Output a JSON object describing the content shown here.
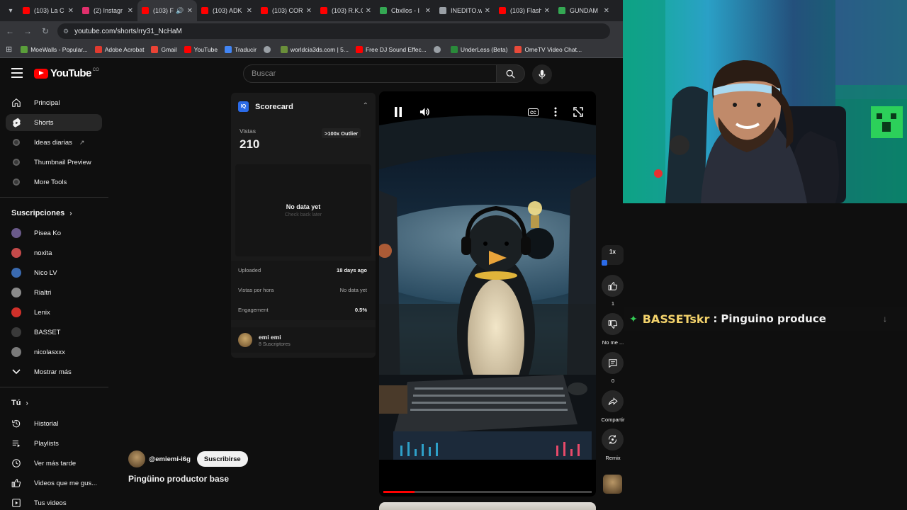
{
  "browser": {
    "tabs": [
      {
        "title": "(103) La C",
        "color": "#ff0000"
      },
      {
        "title": "(2) Instagr",
        "color": "#e1306c"
      },
      {
        "title": "(103) F",
        "color": "#ff0000",
        "active": true
      },
      {
        "title": "(103) ADK",
        "color": "#ff0000"
      },
      {
        "title": "(103) COR",
        "color": "#ff0000"
      },
      {
        "title": "(103) R.K.C",
        "color": "#ff0000"
      },
      {
        "title": "Cbxllos - I",
        "color": "#34a853"
      },
      {
        "title": "INEDITO.w",
        "color": "#9aa0a6"
      },
      {
        "title": "(103) Flash",
        "color": "#ff0000"
      },
      {
        "title": "GUNDAM",
        "color": "#34a853"
      }
    ],
    "url": "youtube.com/shorts/rry31_NcHaM",
    "bookmarks": [
      {
        "label": "MoeWalls - Popular...",
        "color": "#5a9e3a"
      },
      {
        "label": "Adobe Acrobat",
        "color": "#e03a2f"
      },
      {
        "label": "Gmail",
        "color": "#ea4335"
      },
      {
        "label": "YouTube",
        "color": "#ff0000"
      },
      {
        "label": "Traducir",
        "color": "#4285f4"
      },
      {
        "label": "",
        "color": "#9aa0a6"
      },
      {
        "label": "worldcia3ds.com | 5...",
        "color": "#6a8f3a"
      },
      {
        "label": "Free DJ Sound Effec...",
        "color": "#ff0000"
      },
      {
        "label": "",
        "color": "#9aa0a6"
      },
      {
        "label": "UnderLess (Beta)",
        "color": "#2a8a3a"
      },
      {
        "label": "OmeTV Video Chat...",
        "color": "#e84a3a"
      }
    ]
  },
  "youtube": {
    "logo_text": "YouTube",
    "logo_badge": "CO",
    "search_placeholder": "Buscar"
  },
  "sidebar": {
    "main": [
      {
        "label": "Principal",
        "icon": "home-icon"
      },
      {
        "label": "Shorts",
        "icon": "shorts-icon",
        "active": true
      },
      {
        "label": "Ideas diarias",
        "icon": "ideas-icon"
      },
      {
        "label": "Thumbnail Preview",
        "icon": "thumbnail-icon"
      },
      {
        "label": "More Tools",
        "icon": "tools-icon"
      }
    ],
    "subs_title": "Suscripciones",
    "subs": [
      {
        "label": "Pisea Ko",
        "color": "#6a5a8a"
      },
      {
        "label": "noxita",
        "color": "#c44a4a"
      },
      {
        "label": "Nico LV",
        "color": "#3a6ab0"
      },
      {
        "label": "Rialtri",
        "color": "#8a8a8a"
      },
      {
        "label": "Lenix",
        "color": "#d0302a"
      },
      {
        "label": "BASSET",
        "color": "#3a3a3a"
      },
      {
        "label": "nicolasxxx",
        "color": "#7a7a7a"
      }
    ],
    "show_more": "Mostrar más",
    "you_title": "Tú",
    "you": [
      {
        "label": "Historial",
        "icon": "history-icon"
      },
      {
        "label": "Playlists",
        "icon": "playlists-icon"
      },
      {
        "label": "Ver más tarde",
        "icon": "watch-later-icon"
      },
      {
        "label": "Videos que me gus...",
        "icon": "liked-icon"
      },
      {
        "label": "Tus videos",
        "icon": "your-videos-icon"
      }
    ]
  },
  "scorecard": {
    "title": "Scorecard",
    "logo": "IQ",
    "views_label": "Vistas",
    "views_value": "210",
    "outlier_badge": ">100x Outlier",
    "no_data": "No data yet",
    "no_data_sub": "Check back later",
    "stats": [
      {
        "key": "Uploaded",
        "value": "18 days ago",
        "dim": false
      },
      {
        "key": "Vistas por hora",
        "value": "No data yet",
        "dim": true
      },
      {
        "key": "Engagement",
        "value": "0.5%",
        "dim": false
      }
    ],
    "channel_name": "emi emi",
    "channel_subs": "8 Suscriptores"
  },
  "short": {
    "owner_handle": "@emiemi-i6g",
    "subscribe_label": "Suscribirse",
    "title": "Pingüino productor base",
    "progress": 0.15
  },
  "actions": {
    "speed": "1x",
    "likes": "1",
    "dislike_label": "No me ...",
    "comments": "0",
    "share_label": "Compartir",
    "remix_label": "Remix"
  },
  "chat": {
    "user": "BASSETskr",
    "separator": ":",
    "message": "Pinguino produce"
  }
}
